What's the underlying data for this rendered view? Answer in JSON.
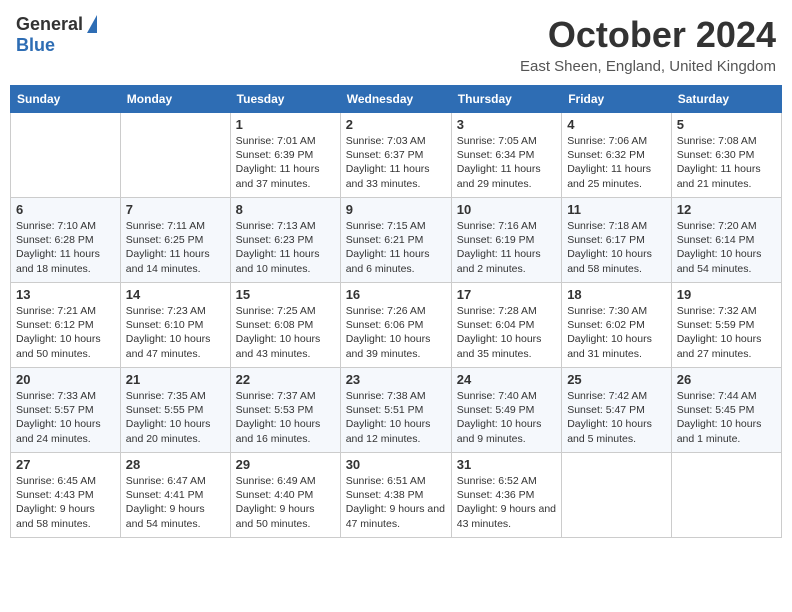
{
  "header": {
    "logo_general": "General",
    "logo_blue": "Blue",
    "month_title": "October 2024",
    "subtitle": "East Sheen, England, United Kingdom"
  },
  "days_of_week": [
    "Sunday",
    "Monday",
    "Tuesday",
    "Wednesday",
    "Thursday",
    "Friday",
    "Saturday"
  ],
  "weeks": [
    [
      {
        "date": "",
        "detail": ""
      },
      {
        "date": "",
        "detail": ""
      },
      {
        "date": "1",
        "detail": "Sunrise: 7:01 AM\nSunset: 6:39 PM\nDaylight: 11 hours and 37 minutes."
      },
      {
        "date": "2",
        "detail": "Sunrise: 7:03 AM\nSunset: 6:37 PM\nDaylight: 11 hours and 33 minutes."
      },
      {
        "date": "3",
        "detail": "Sunrise: 7:05 AM\nSunset: 6:34 PM\nDaylight: 11 hours and 29 minutes."
      },
      {
        "date": "4",
        "detail": "Sunrise: 7:06 AM\nSunset: 6:32 PM\nDaylight: 11 hours and 25 minutes."
      },
      {
        "date": "5",
        "detail": "Sunrise: 7:08 AM\nSunset: 6:30 PM\nDaylight: 11 hours and 21 minutes."
      }
    ],
    [
      {
        "date": "6",
        "detail": "Sunrise: 7:10 AM\nSunset: 6:28 PM\nDaylight: 11 hours and 18 minutes."
      },
      {
        "date": "7",
        "detail": "Sunrise: 7:11 AM\nSunset: 6:25 PM\nDaylight: 11 hours and 14 minutes."
      },
      {
        "date": "8",
        "detail": "Sunrise: 7:13 AM\nSunset: 6:23 PM\nDaylight: 11 hours and 10 minutes."
      },
      {
        "date": "9",
        "detail": "Sunrise: 7:15 AM\nSunset: 6:21 PM\nDaylight: 11 hours and 6 minutes."
      },
      {
        "date": "10",
        "detail": "Sunrise: 7:16 AM\nSunset: 6:19 PM\nDaylight: 11 hours and 2 minutes."
      },
      {
        "date": "11",
        "detail": "Sunrise: 7:18 AM\nSunset: 6:17 PM\nDaylight: 10 hours and 58 minutes."
      },
      {
        "date": "12",
        "detail": "Sunrise: 7:20 AM\nSunset: 6:14 PM\nDaylight: 10 hours and 54 minutes."
      }
    ],
    [
      {
        "date": "13",
        "detail": "Sunrise: 7:21 AM\nSunset: 6:12 PM\nDaylight: 10 hours and 50 minutes."
      },
      {
        "date": "14",
        "detail": "Sunrise: 7:23 AM\nSunset: 6:10 PM\nDaylight: 10 hours and 47 minutes."
      },
      {
        "date": "15",
        "detail": "Sunrise: 7:25 AM\nSunset: 6:08 PM\nDaylight: 10 hours and 43 minutes."
      },
      {
        "date": "16",
        "detail": "Sunrise: 7:26 AM\nSunset: 6:06 PM\nDaylight: 10 hours and 39 minutes."
      },
      {
        "date": "17",
        "detail": "Sunrise: 7:28 AM\nSunset: 6:04 PM\nDaylight: 10 hours and 35 minutes."
      },
      {
        "date": "18",
        "detail": "Sunrise: 7:30 AM\nSunset: 6:02 PM\nDaylight: 10 hours and 31 minutes."
      },
      {
        "date": "19",
        "detail": "Sunrise: 7:32 AM\nSunset: 5:59 PM\nDaylight: 10 hours and 27 minutes."
      }
    ],
    [
      {
        "date": "20",
        "detail": "Sunrise: 7:33 AM\nSunset: 5:57 PM\nDaylight: 10 hours and 24 minutes."
      },
      {
        "date": "21",
        "detail": "Sunrise: 7:35 AM\nSunset: 5:55 PM\nDaylight: 10 hours and 20 minutes."
      },
      {
        "date": "22",
        "detail": "Sunrise: 7:37 AM\nSunset: 5:53 PM\nDaylight: 10 hours and 16 minutes."
      },
      {
        "date": "23",
        "detail": "Sunrise: 7:38 AM\nSunset: 5:51 PM\nDaylight: 10 hours and 12 minutes."
      },
      {
        "date": "24",
        "detail": "Sunrise: 7:40 AM\nSunset: 5:49 PM\nDaylight: 10 hours and 9 minutes."
      },
      {
        "date": "25",
        "detail": "Sunrise: 7:42 AM\nSunset: 5:47 PM\nDaylight: 10 hours and 5 minutes."
      },
      {
        "date": "26",
        "detail": "Sunrise: 7:44 AM\nSunset: 5:45 PM\nDaylight: 10 hours and 1 minute."
      }
    ],
    [
      {
        "date": "27",
        "detail": "Sunrise: 6:45 AM\nSunset: 4:43 PM\nDaylight: 9 hours and 58 minutes."
      },
      {
        "date": "28",
        "detail": "Sunrise: 6:47 AM\nSunset: 4:41 PM\nDaylight: 9 hours and 54 minutes."
      },
      {
        "date": "29",
        "detail": "Sunrise: 6:49 AM\nSunset: 4:40 PM\nDaylight: 9 hours and 50 minutes."
      },
      {
        "date": "30",
        "detail": "Sunrise: 6:51 AM\nSunset: 4:38 PM\nDaylight: 9 hours and 47 minutes."
      },
      {
        "date": "31",
        "detail": "Sunrise: 6:52 AM\nSunset: 4:36 PM\nDaylight: 9 hours and 43 minutes."
      },
      {
        "date": "",
        "detail": ""
      },
      {
        "date": "",
        "detail": ""
      }
    ]
  ]
}
